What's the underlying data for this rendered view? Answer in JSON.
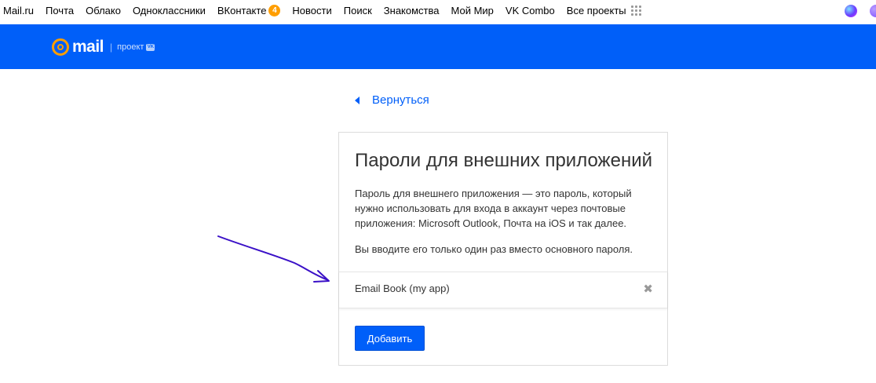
{
  "portal": {
    "links": [
      "Mail.ru",
      "Почта",
      "Облако",
      "Одноклассники",
      "ВКонтакте",
      "Новости",
      "Поиск",
      "Знакомства",
      "Мой Мир",
      "VK Combo",
      "Все проекты"
    ],
    "vk_badge": "4"
  },
  "header": {
    "logo_text": "mail",
    "logo_separator": "|",
    "logo_sub": "проект",
    "logo_vk": "VK",
    "accent_color": "#005ff9",
    "logo_color": "#ff9e00"
  },
  "back": {
    "label": "Вернуться"
  },
  "card": {
    "title": "Пароли для внешних приложений",
    "description": "Пароль для внешнего приложения — это пароль, который нужно использовать для входа в аккаунт через почтовые приложения: Microsoft Outlook, Почта на iOS и так далее.",
    "note": "Вы вводите его только один раз вместо основного пароля.",
    "apps": [
      {
        "name": "Email Book (my app)",
        "remove_icon": "✖"
      }
    ],
    "add_label": "Добавить"
  }
}
